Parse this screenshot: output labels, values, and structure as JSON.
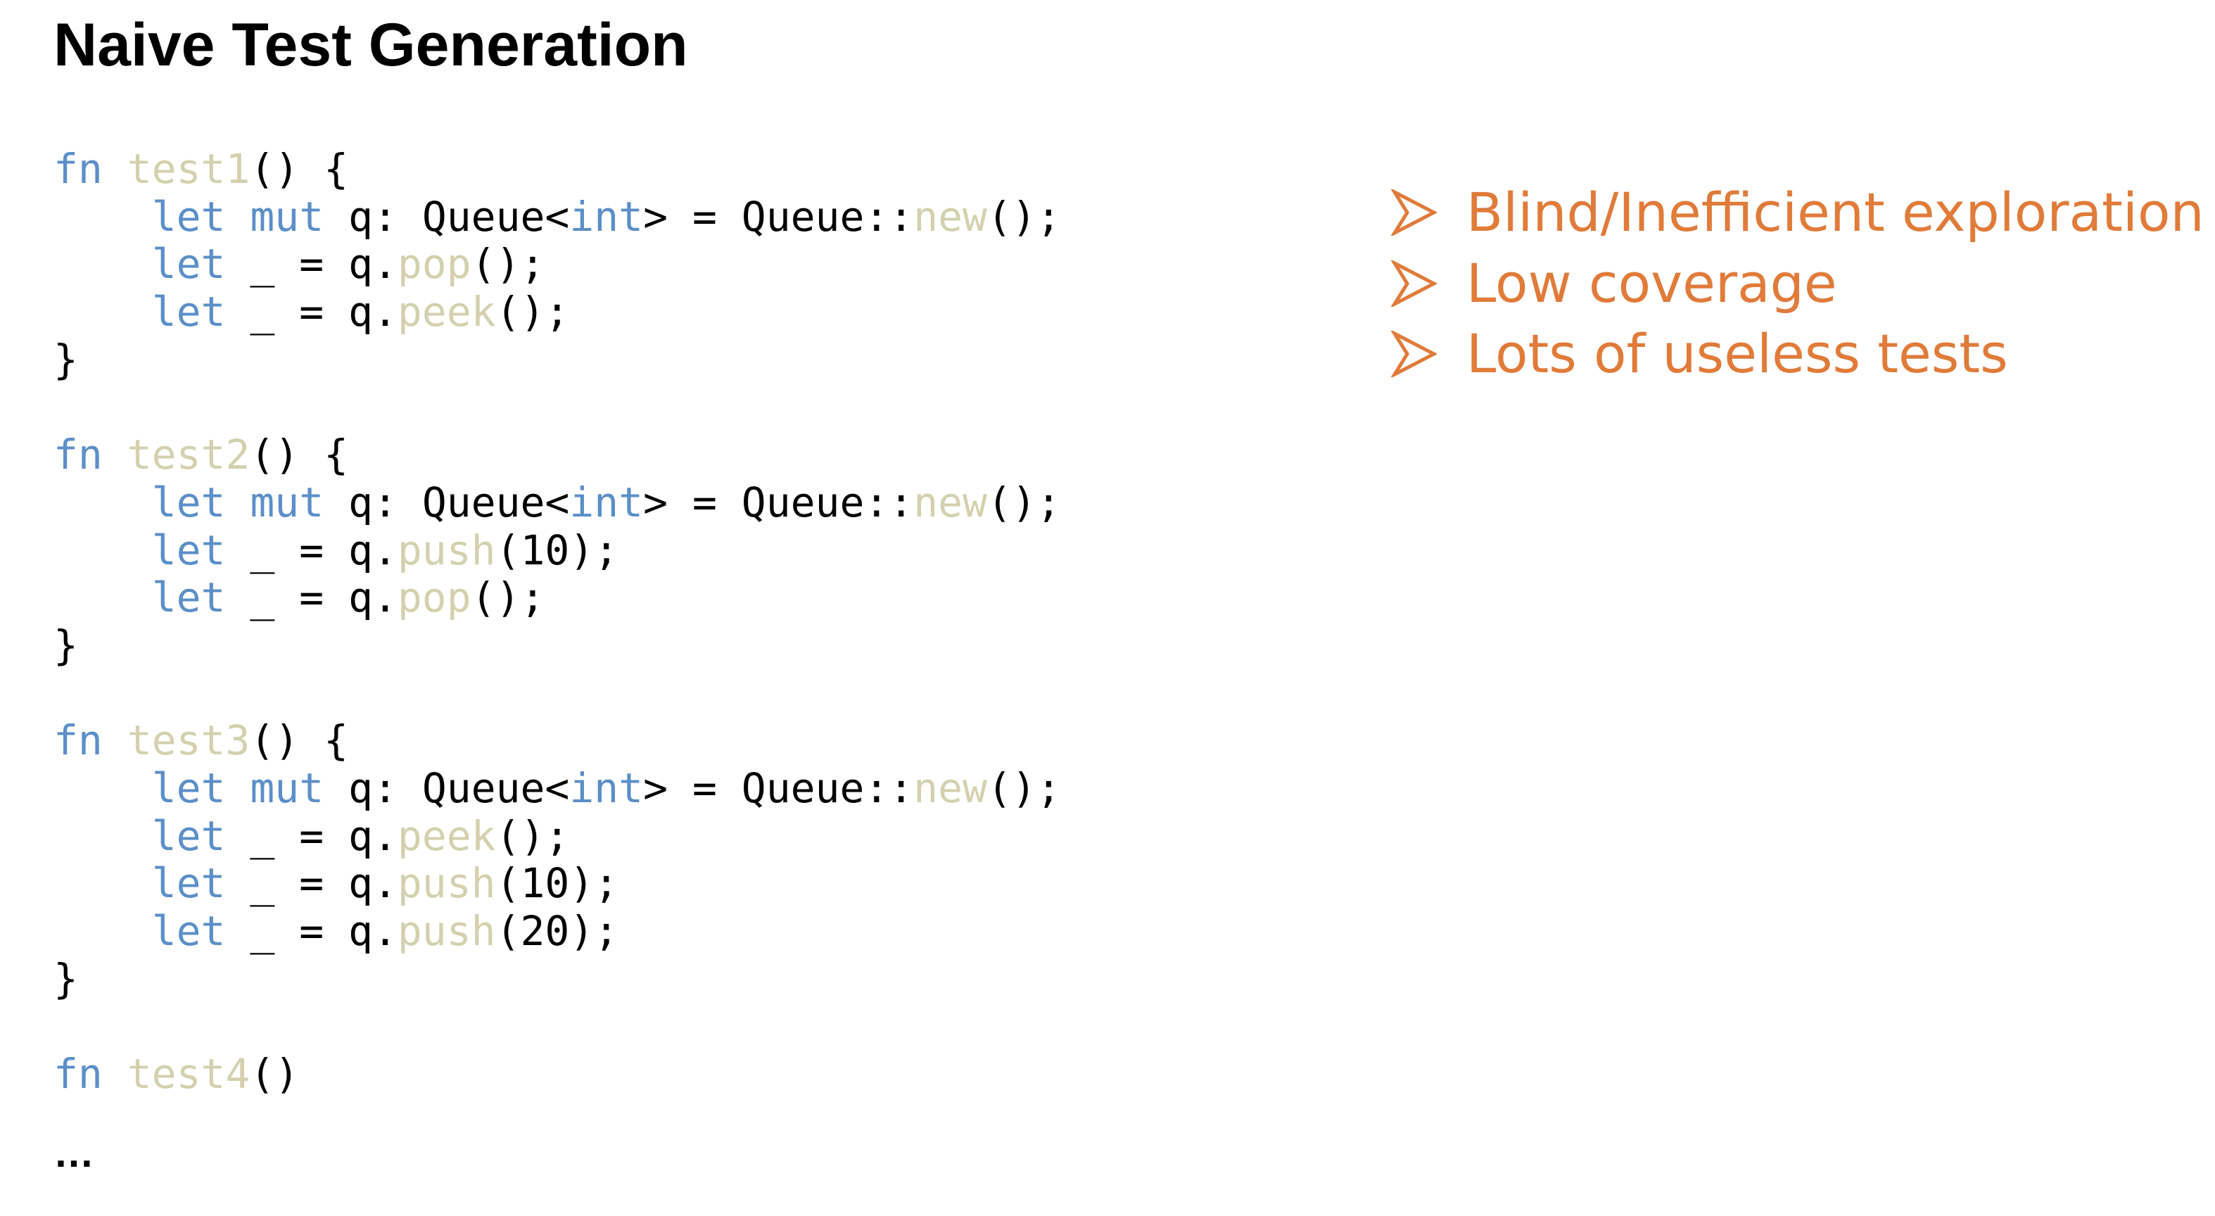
{
  "slide": {
    "title": "Naive Test Generation",
    "ellipsis": "…"
  },
  "code": {
    "lines": [
      [
        {
          "t": "kw",
          "v": "fn"
        },
        {
          "t": "plain",
          "v": " "
        },
        {
          "t": "fn",
          "v": "test1"
        },
        {
          "t": "plain",
          "v": "() {"
        }
      ],
      [
        {
          "t": "plain",
          "v": "    "
        },
        {
          "t": "kw",
          "v": "let"
        },
        {
          "t": "plain",
          "v": " "
        },
        {
          "t": "kw",
          "v": "mut"
        },
        {
          "t": "plain",
          "v": " q: Queue<"
        },
        {
          "t": "kw",
          "v": "int"
        },
        {
          "t": "plain",
          "v": "> = Queue::"
        },
        {
          "t": "fn",
          "v": "new"
        },
        {
          "t": "plain",
          "v": "();"
        }
      ],
      [
        {
          "t": "plain",
          "v": "    "
        },
        {
          "t": "kw",
          "v": "let"
        },
        {
          "t": "plain",
          "v": " _ = q."
        },
        {
          "t": "fn",
          "v": "pop"
        },
        {
          "t": "plain",
          "v": "();"
        }
      ],
      [
        {
          "t": "plain",
          "v": "    "
        },
        {
          "t": "kw",
          "v": "let"
        },
        {
          "t": "plain",
          "v": " _ = q."
        },
        {
          "t": "fn",
          "v": "peek"
        },
        {
          "t": "plain",
          "v": "();"
        }
      ],
      [
        {
          "t": "plain",
          "v": "}"
        }
      ],
      [],
      [
        {
          "t": "kw",
          "v": "fn"
        },
        {
          "t": "plain",
          "v": " "
        },
        {
          "t": "fn",
          "v": "test2"
        },
        {
          "t": "plain",
          "v": "() {"
        }
      ],
      [
        {
          "t": "plain",
          "v": "    "
        },
        {
          "t": "kw",
          "v": "let"
        },
        {
          "t": "plain",
          "v": " "
        },
        {
          "t": "kw",
          "v": "mut"
        },
        {
          "t": "plain",
          "v": " q: Queue<"
        },
        {
          "t": "kw",
          "v": "int"
        },
        {
          "t": "plain",
          "v": "> = Queue::"
        },
        {
          "t": "fn",
          "v": "new"
        },
        {
          "t": "plain",
          "v": "();"
        }
      ],
      [
        {
          "t": "plain",
          "v": "    "
        },
        {
          "t": "kw",
          "v": "let"
        },
        {
          "t": "plain",
          "v": " _ = q."
        },
        {
          "t": "fn",
          "v": "push"
        },
        {
          "t": "plain",
          "v": "(10);"
        }
      ],
      [
        {
          "t": "plain",
          "v": "    "
        },
        {
          "t": "kw",
          "v": "let"
        },
        {
          "t": "plain",
          "v": " _ = q."
        },
        {
          "t": "fn",
          "v": "pop"
        },
        {
          "t": "plain",
          "v": "();"
        }
      ],
      [
        {
          "t": "plain",
          "v": "}"
        }
      ],
      [],
      [
        {
          "t": "kw",
          "v": "fn"
        },
        {
          "t": "plain",
          "v": " "
        },
        {
          "t": "fn",
          "v": "test3"
        },
        {
          "t": "plain",
          "v": "() {"
        }
      ],
      [
        {
          "t": "plain",
          "v": "    "
        },
        {
          "t": "kw",
          "v": "let"
        },
        {
          "t": "plain",
          "v": " "
        },
        {
          "t": "kw",
          "v": "mut"
        },
        {
          "t": "plain",
          "v": " q: Queue<"
        },
        {
          "t": "kw",
          "v": "int"
        },
        {
          "t": "plain",
          "v": "> = Queue::"
        },
        {
          "t": "fn",
          "v": "new"
        },
        {
          "t": "plain",
          "v": "();"
        }
      ],
      [
        {
          "t": "plain",
          "v": "    "
        },
        {
          "t": "kw",
          "v": "let"
        },
        {
          "t": "plain",
          "v": " _ = q."
        },
        {
          "t": "fn",
          "v": "peek"
        },
        {
          "t": "plain",
          "v": "();"
        }
      ],
      [
        {
          "t": "plain",
          "v": "    "
        },
        {
          "t": "kw",
          "v": "let"
        },
        {
          "t": "plain",
          "v": " _ = q."
        },
        {
          "t": "fn",
          "v": "push"
        },
        {
          "t": "plain",
          "v": "(10);"
        }
      ],
      [
        {
          "t": "plain",
          "v": "    "
        },
        {
          "t": "kw",
          "v": "let"
        },
        {
          "t": "plain",
          "v": " _ = q."
        },
        {
          "t": "fn",
          "v": "push"
        },
        {
          "t": "plain",
          "v": "(20);"
        }
      ],
      [
        {
          "t": "plain",
          "v": "}"
        }
      ],
      [],
      [
        {
          "t": "kw",
          "v": "fn"
        },
        {
          "t": "plain",
          "v": " "
        },
        {
          "t": "fn",
          "v": "test4"
        },
        {
          "t": "plain",
          "v": "()"
        }
      ]
    ]
  },
  "bullets": {
    "icon": "arrowhead-bullet-icon",
    "items": [
      "Blind/Inefficient exploration",
      "Low coverage",
      "Lots of useless tests"
    ]
  },
  "colors": {
    "keyword": "#5b8fc7",
    "function_name": "#d4d0ad",
    "plain_text": "#000000",
    "bullet_text": "#e07b39",
    "background": "#ffffff"
  }
}
